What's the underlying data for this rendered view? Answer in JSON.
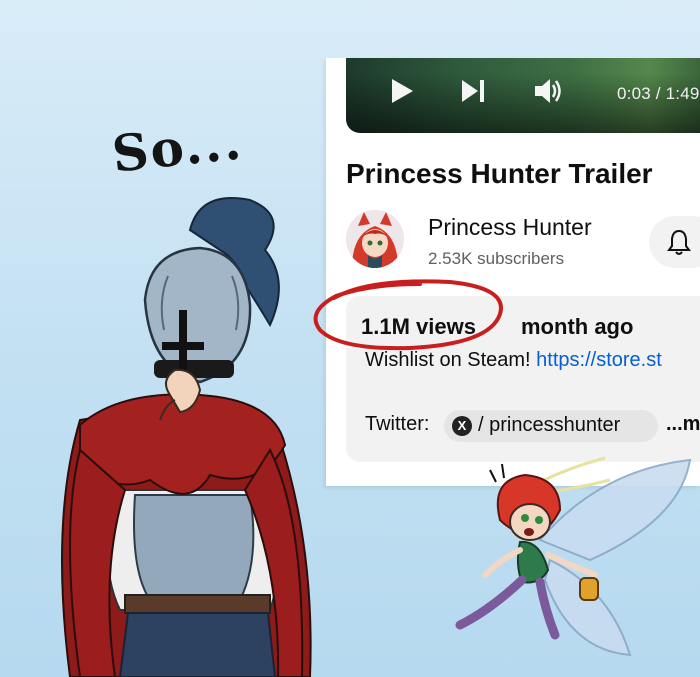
{
  "caption": {
    "text": "So..."
  },
  "video": {
    "time": "0:03 / 1:49",
    "controls": {
      "play_icon": "play-icon",
      "next_icon": "skip-next-icon",
      "volume_icon": "volume-icon"
    },
    "title": "Princess Hunter Trailer"
  },
  "channel": {
    "name": "Princess Hunter",
    "subscribers": "2.53K subscribers",
    "bell_icon": "bell-icon"
  },
  "description": {
    "views": "1.1M views",
    "date": "month ago",
    "line1_text": "Wishlist on Steam! ",
    "line1_link": "https://store.st",
    "twitter_label": "Twitter:",
    "twitter_handle": "/ princesshunter",
    "more": "...m"
  },
  "colors": {
    "background": "#c2e0f2",
    "circle_annotation": "#c81e1e",
    "link": "#065fd4",
    "cape": "#9c1d1d",
    "fairy_hair": "#d9362a"
  }
}
